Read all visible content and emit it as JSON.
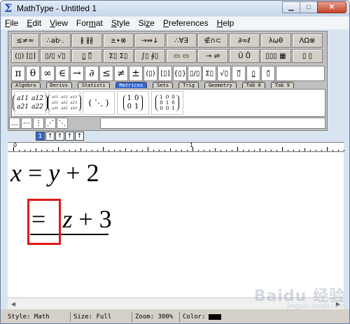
{
  "window": {
    "title": "MathType - Untitled 1",
    "app_icon": "sigma-icon",
    "controls": [
      "minimize",
      "maximize",
      "close"
    ]
  },
  "menubar": {
    "items": [
      {
        "label": "File",
        "key": "F"
      },
      {
        "label": "Edit",
        "key": "E"
      },
      {
        "label": "View",
        "key": "V"
      },
      {
        "label": "Format",
        "key": "m"
      },
      {
        "label": "Style",
        "key": "S"
      },
      {
        "label": "Size",
        "key": "z"
      },
      {
        "label": "Preferences",
        "key": "P"
      },
      {
        "label": "Help",
        "key": "H"
      }
    ]
  },
  "symbol_palette_row1": [
    "≤≠≈",
    "∴ab·.",
    "∦ ∦∦",
    "±•⊗",
    "→⇔↓",
    "∴∀∃",
    "∉∩⊂",
    "∂∞ℓ",
    "λωθ",
    "ΛΩ⊗"
  ],
  "template_palette_row2": [
    "(▯) [▯]",
    "▯/▯ √▯",
    "▯̲ ▯̅",
    "Σ▯ Σ▯",
    "∫▯ ∮▯",
    "▭ ▭",
    "→ ⇌",
    "Ū Ů",
    "▯▯▯ ▦",
    "▯ ▯"
  ],
  "small_bar_row3": [
    "π",
    "θ",
    "∞",
    "∈",
    "→",
    "∂",
    "≤",
    "≠",
    "±",
    "(▯)",
    "[▯]",
    "{▯}",
    "▯/▯",
    "Σ▯",
    "√▯",
    "▯̅",
    "▯̲",
    "▯̆"
  ],
  "tabs": [
    {
      "label": "Algebra",
      "active": false
    },
    {
      "label": "Derivs",
      "active": false
    },
    {
      "label": "Statisti",
      "active": false
    },
    {
      "label": "Matrices",
      "active": true
    },
    {
      "label": "Sets",
      "active": false
    },
    {
      "label": "Trig",
      "active": false
    },
    {
      "label": "Geometry",
      "active": false
    },
    {
      "label": "Tab 8",
      "active": false
    },
    {
      "label": "Tab 9",
      "active": false
    }
  ],
  "matrix_templates": {
    "m2_symbolic": [
      "a11",
      "a12",
      "a21",
      "a22"
    ],
    "m3_symbolic": [
      "a11",
      "a12",
      "a13",
      "a21",
      "a22",
      "a23",
      "a31",
      "a32",
      "a33"
    ],
    "identity_2": [
      "1",
      "0",
      "0",
      "1"
    ],
    "identity_3": [
      "1",
      "0",
      "0",
      "0",
      "1",
      "0",
      "0",
      "0",
      "1"
    ]
  },
  "bottom_row_symbols": [
    "…",
    "⋯",
    "⋮",
    "⋰",
    "⋱"
  ],
  "nesting_buttons": [
    "1",
    "↑",
    "↑",
    "↑",
    "↑"
  ],
  "ruler": {
    "labels": [
      "0",
      "1"
    ]
  },
  "document": {
    "line1": {
      "lhs": "x",
      "eq": "=",
      "var": "y",
      "op": "+",
      "num": "2"
    },
    "line2": {
      "eq": "=",
      "var": "z",
      "op": "+",
      "num": "3"
    }
  },
  "status": {
    "style": "Style: Math",
    "size": "Size: Full",
    "zoom": "Zoom: 300%",
    "color_label": "Color:",
    "color": "#000000"
  },
  "watermark": {
    "main": "Baidu 经验",
    "sub": "jingyan.baidu.com"
  }
}
